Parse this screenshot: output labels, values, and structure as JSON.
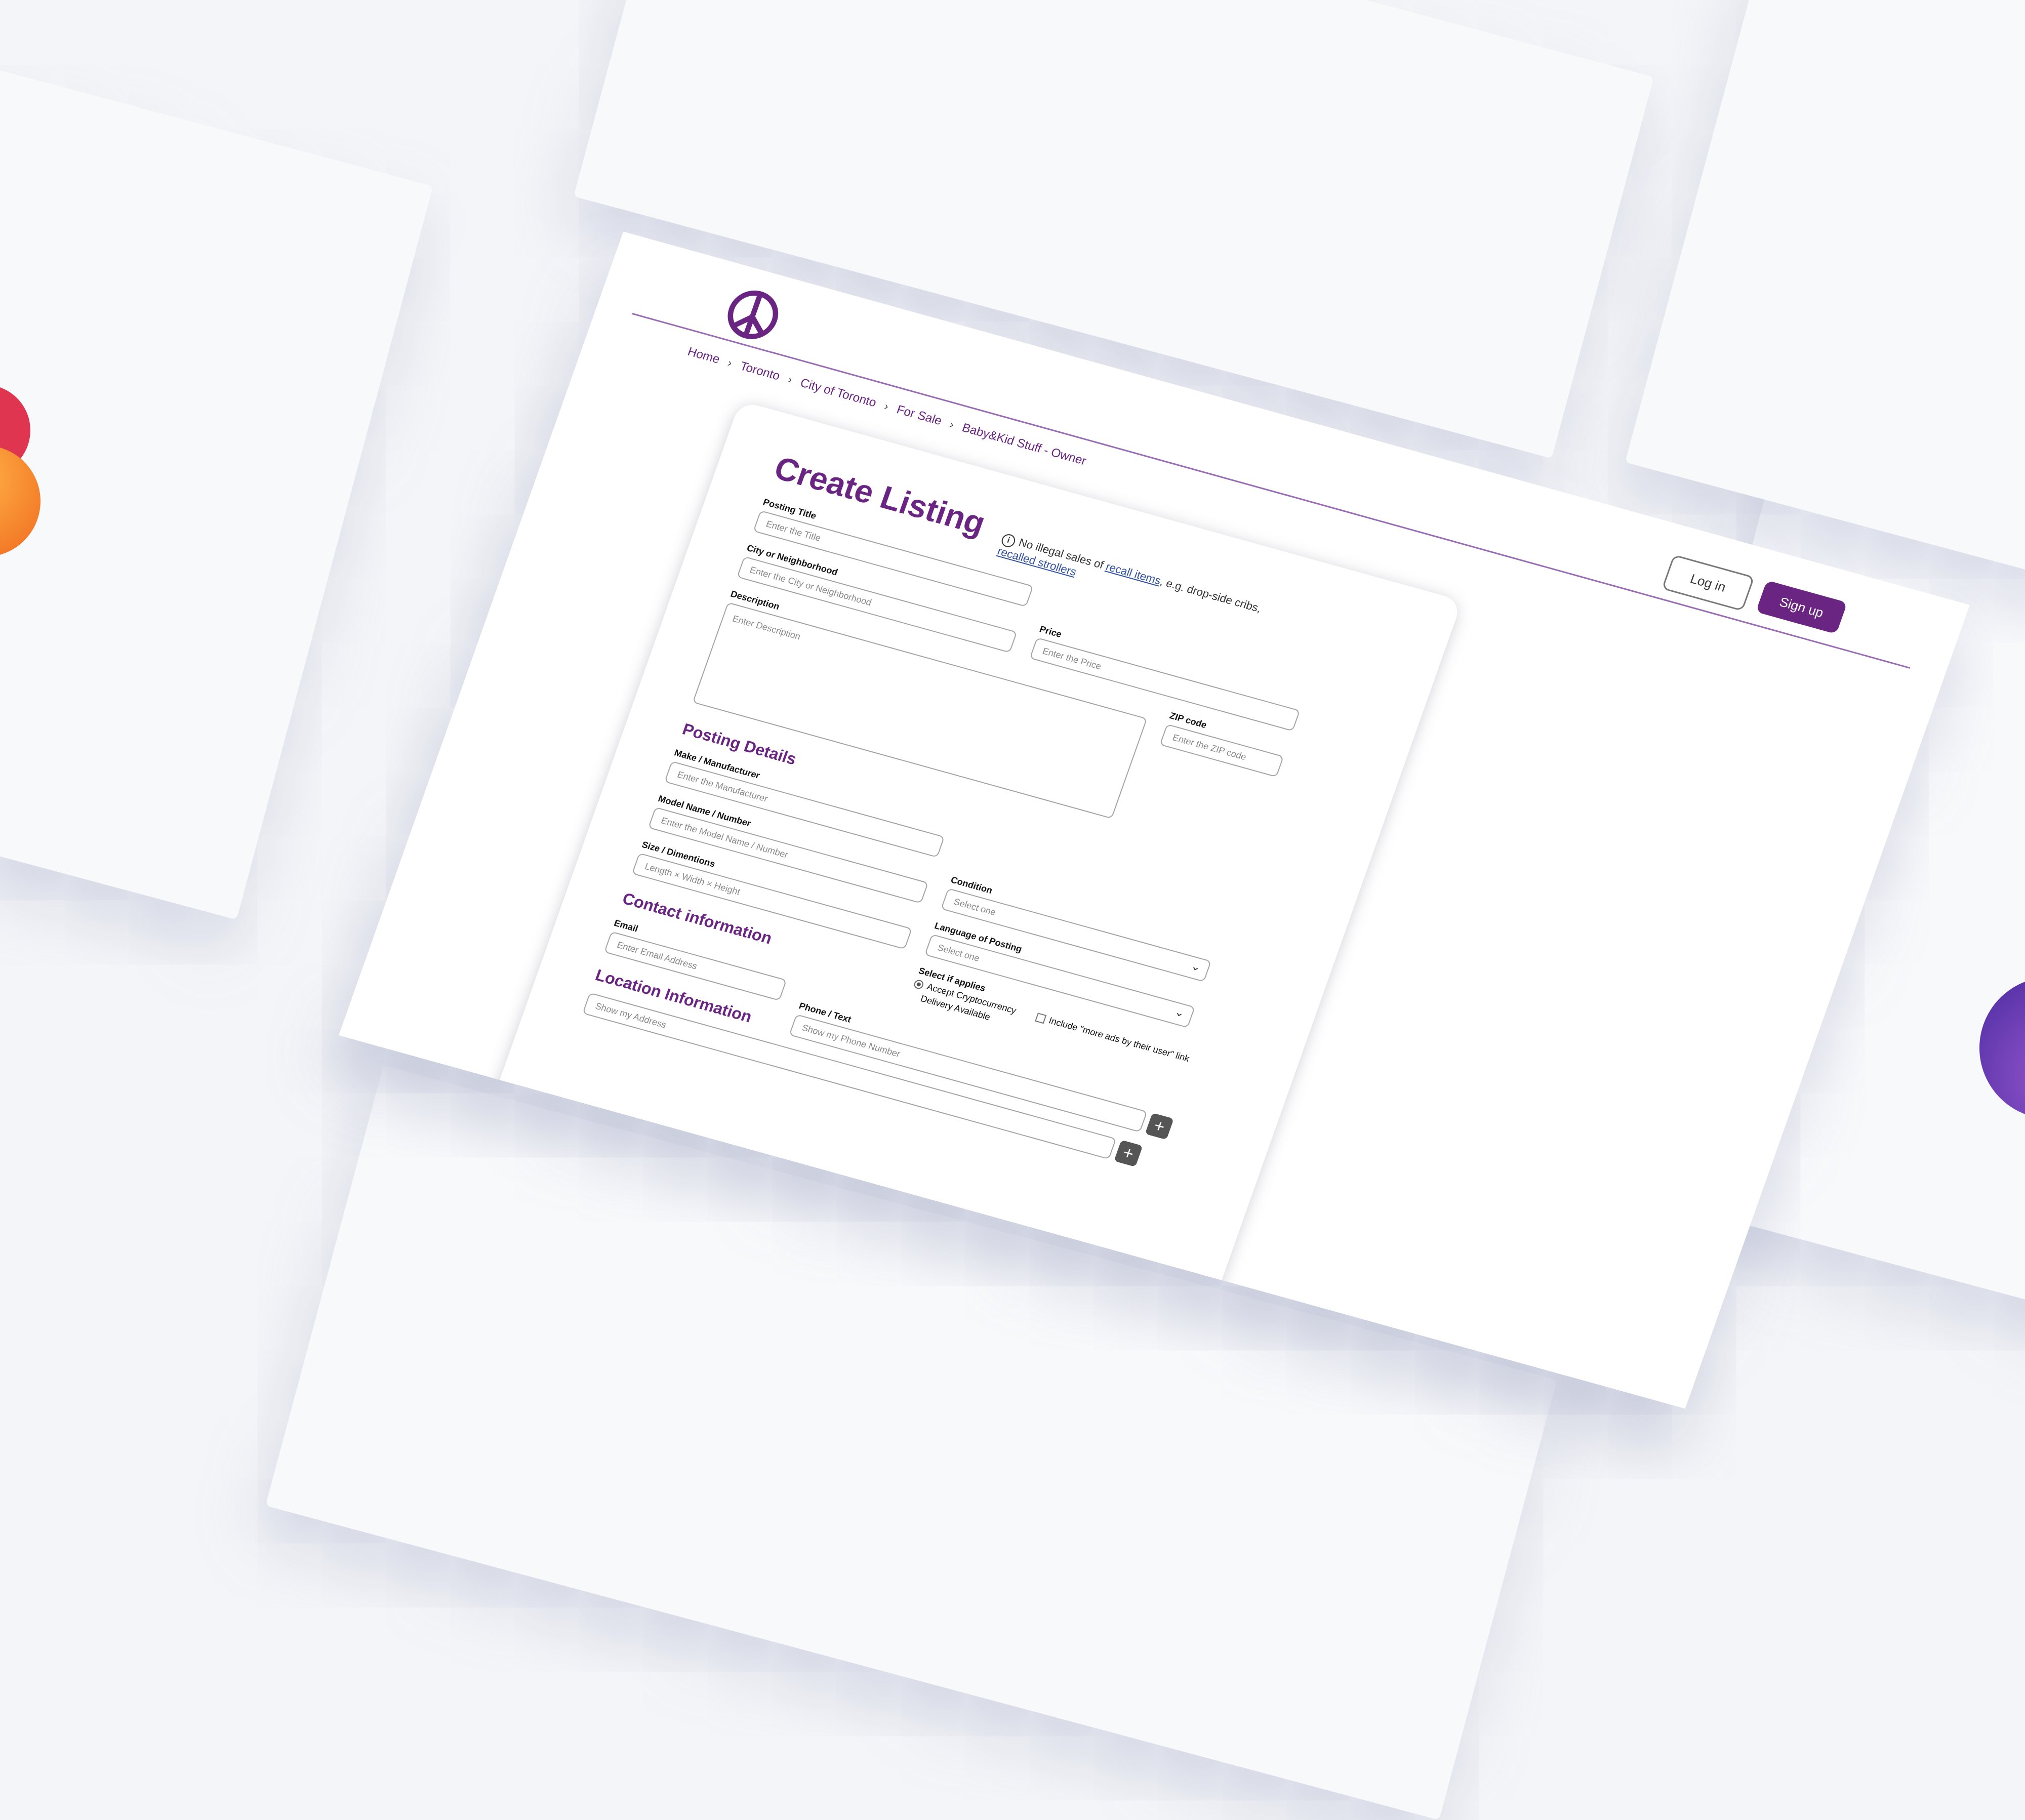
{
  "header": {
    "logo_icon": "peace-sign-icon",
    "login_label": "Log in",
    "signup_label": "Sign up"
  },
  "breadcrumb": [
    "Home",
    "Toronto",
    "City of Toronto",
    "For Sale",
    "Baby&Kid Stuff - Owner"
  ],
  "form": {
    "title": "Create Listing",
    "notice_prefix": "No illegal sales of ",
    "notice_link_1": "recall items",
    "notice_mid": ", e.g. drop-side cribs, ",
    "notice_link_2": "recalled strollers",
    "posting_title_label": "Posting Title",
    "posting_title_placeholder": "Enter the Title",
    "city_label": "City or Neighborhood",
    "city_placeholder": "Enter the City or Neighborhood",
    "price_label": "Price",
    "price_placeholder": "Enter the Price",
    "description_label": "Description",
    "description_placeholder": "Enter Description",
    "zip_label": "ZIP code",
    "zip_placeholder": "Enter the ZIP code"
  },
  "posting_details": {
    "heading": "Posting Details",
    "make_label": "Make / Manufacturer",
    "make_placeholder": "Enter the Manufacturer",
    "model_label": "Model Name / Number",
    "model_placeholder": "Enter the Model Name / Number",
    "size_label": "Size / Dimentions",
    "size_placeholder": "Length × Width × Height",
    "condition_label": "Condition",
    "condition_value": "Select one",
    "language_label": "Language of Posting",
    "language_value": "Select one",
    "applies_label": "Select if applies",
    "option_crypto": "Accept Cryptocurrency",
    "option_delivery": "Delivery Available",
    "option_more_ads": "Include \"more ads by their user\" link"
  },
  "contact": {
    "heading": "Contact information",
    "email_label": "Email",
    "email_placeholder": "Enter Email Address",
    "phone_label": "Phone / Text",
    "phone_placeholder": "Show my Phone Number"
  },
  "location": {
    "heading": "Location Information",
    "address_placeholder": "Show my Address"
  },
  "colors": {
    "brand": "#6a2583",
    "link": "#3050a0",
    "line": "#9a6bb5"
  }
}
